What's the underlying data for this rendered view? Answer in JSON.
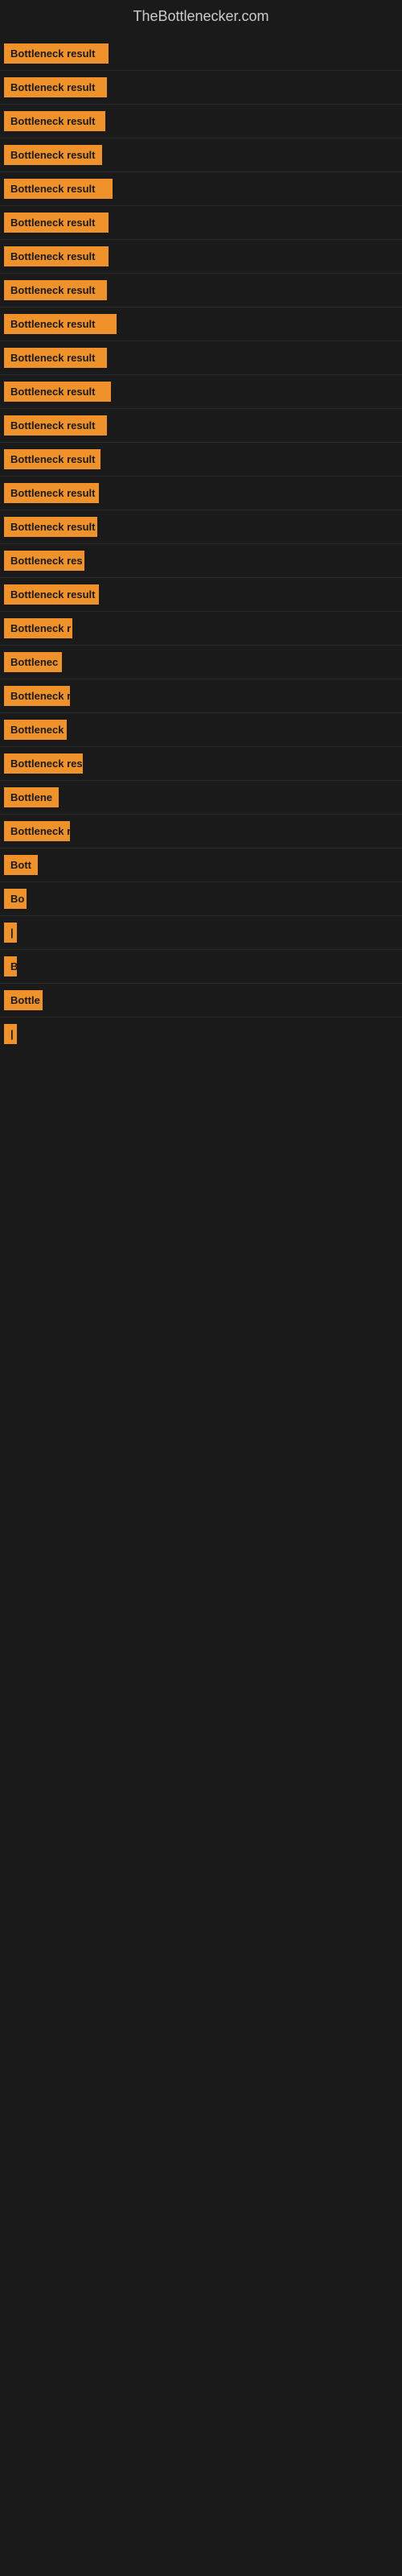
{
  "site": {
    "title": "TheBottlenecker.com"
  },
  "bars": [
    {
      "label": "Bottleneck result",
      "width": 130
    },
    {
      "label": "Bottleneck result",
      "width": 128
    },
    {
      "label": "Bottleneck result",
      "width": 126
    },
    {
      "label": "Bottleneck result",
      "width": 122
    },
    {
      "label": "Bottleneck result",
      "width": 135
    },
    {
      "label": "Bottleneck result",
      "width": 130
    },
    {
      "label": "Bottleneck result",
      "width": 130
    },
    {
      "label": "Bottleneck result",
      "width": 128
    },
    {
      "label": "Bottleneck result",
      "width": 140
    },
    {
      "label": "Bottleneck result",
      "width": 128
    },
    {
      "label": "Bottleneck result",
      "width": 133
    },
    {
      "label": "Bottleneck result",
      "width": 128
    },
    {
      "label": "Bottleneck result",
      "width": 120
    },
    {
      "label": "Bottleneck result",
      "width": 118
    },
    {
      "label": "Bottleneck result",
      "width": 116
    },
    {
      "label": "Bottleneck res",
      "width": 100
    },
    {
      "label": "Bottleneck result",
      "width": 118
    },
    {
      "label": "Bottleneck r",
      "width": 85
    },
    {
      "label": "Bottlenec",
      "width": 72
    },
    {
      "label": "Bottleneck r",
      "width": 82
    },
    {
      "label": "Bottleneck",
      "width": 78
    },
    {
      "label": "Bottleneck res",
      "width": 98
    },
    {
      "label": "Bottlene",
      "width": 68
    },
    {
      "label": "Bottleneck r",
      "width": 82
    },
    {
      "label": "Bott",
      "width": 42
    },
    {
      "label": "Bo",
      "width": 28
    },
    {
      "label": "|",
      "width": 8
    },
    {
      "label": "B",
      "width": 14
    },
    {
      "label": "Bottle",
      "width": 48
    },
    {
      "label": "|",
      "width": 6
    }
  ]
}
